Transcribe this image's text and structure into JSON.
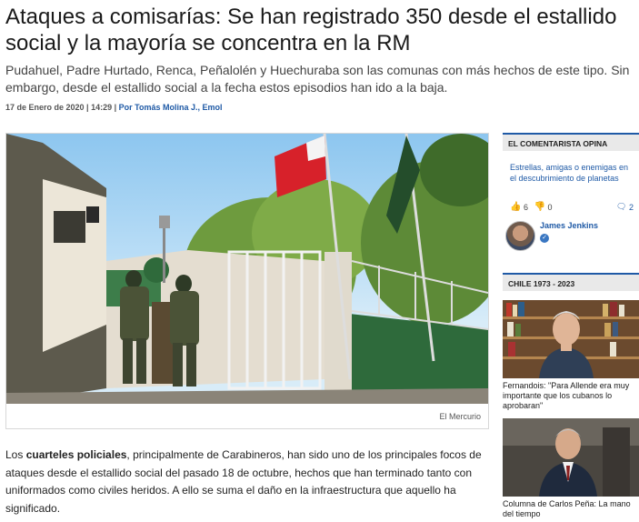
{
  "article": {
    "headline": "Ataques a comisarías: Se han registrado 350 desde el estallido social y la mayoría se concentra en la RM",
    "subheadline": "Pudahuel, Padre Hurtado, Renca, Peñalolén y Huechuraba son las comunas con más hechos de este tipo. Sin embargo, desde el estallido social a la fecha estos episodios han ido a la baja.",
    "date": "17 de Enero de 2020 | 14:29 |",
    "author": "Por Tomás Molina J., Emol",
    "photo_credit": "El Mercurio",
    "body_start": "Los ",
    "body_bold": "cuarteles policiales",
    "body_rest": ", principalmente de Carabineros, han sido uno de los principales focos de ataques desde el estallido social del pasado 18 de octubre, hechos que han terminado tanto con uniformados como civiles heridos. A ello se suma el daño en la infraestructura que aquello ha significado."
  },
  "sidebar": {
    "comentarista": {
      "heading": "EL COMENTARISTA OPINA",
      "link": "Estrellas, amigas o enemigas en el descubrimiento de planetas",
      "likes": "6",
      "dislikes": "0",
      "comments": "2",
      "name": "James Jenkins"
    },
    "chile": {
      "heading": "CHILE 1973 - 2023",
      "item1_caption": "Fernandois: \"Para Allende era muy importante que los cubanos lo aprobaran\"",
      "item2_caption": "Columna de Carlos Peña: La mano del tiempo"
    }
  },
  "colors": {
    "accent": "#1f5aa6",
    "link": "#1f5aa6"
  }
}
